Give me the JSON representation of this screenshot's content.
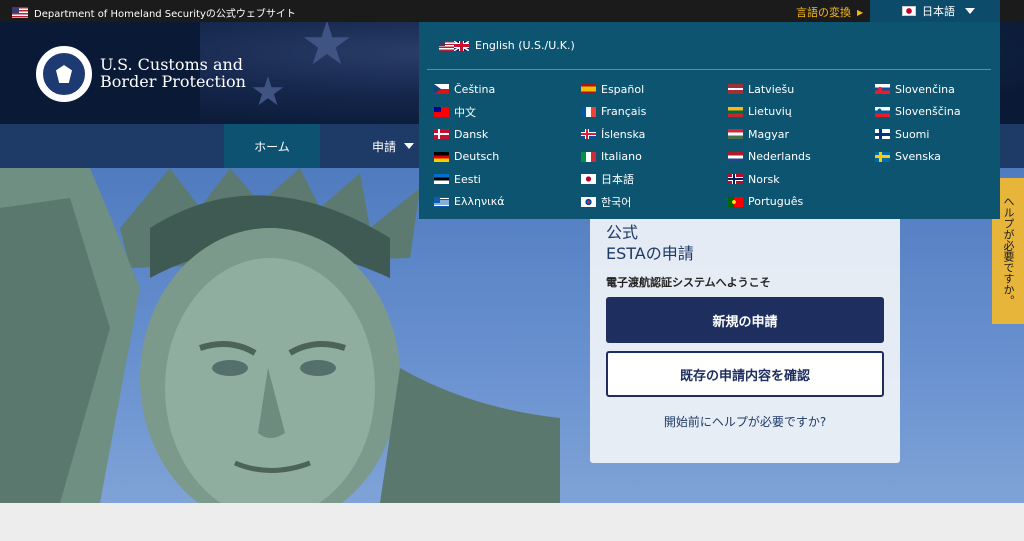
{
  "topbar": {
    "agency_text": "Department of Homeland Securityの公式ウェブサイト",
    "language_toggle_label": "言語の変換",
    "current_language": "日本語"
  },
  "header": {
    "agency_name_line1": "U.S. Customs and",
    "agency_name_line2": "Border Protection"
  },
  "nav": {
    "home": "ホーム",
    "apply": "申請"
  },
  "card": {
    "title_line1": "公式",
    "title_line2": "ESTAの申請",
    "subtitle": "電子渡航認証システムへようこそ",
    "new_application": "新規の申請",
    "existing_application": "既存の申請内容を確認",
    "help_link": "開始前にヘルプが必要ですか?"
  },
  "side_help": {
    "label": "ヘルプが必要ですか。"
  },
  "language_menu": {
    "english": "English (U.S./U.K.)",
    "columns": [
      [
        {
          "label": "Čeština",
          "flag": "cs"
        },
        {
          "label": "中文",
          "flag": "zh"
        },
        {
          "label": "Dansk",
          "flag": "da"
        },
        {
          "label": "Deutsch",
          "flag": "de"
        },
        {
          "label": "Eesti",
          "flag": "et"
        },
        {
          "label": "Ελληνικά",
          "flag": "el"
        }
      ],
      [
        {
          "label": "Español",
          "flag": "es"
        },
        {
          "label": "Français",
          "flag": "fr"
        },
        {
          "label": "Íslenska",
          "flag": "is"
        },
        {
          "label": "Italiano",
          "flag": "it"
        },
        {
          "label": "日本語",
          "flag": "ja"
        },
        {
          "label": "한국어",
          "flag": "ko"
        }
      ],
      [
        {
          "label": "Latviešu",
          "flag": "lv"
        },
        {
          "label": "Lietuvių",
          "flag": "lt"
        },
        {
          "label": "Magyar",
          "flag": "hu"
        },
        {
          "label": "Nederlands",
          "flag": "nl"
        },
        {
          "label": "Norsk",
          "flag": "no"
        },
        {
          "label": "Português",
          "flag": "pt"
        }
      ],
      [
        {
          "label": "Slovenčina",
          "flag": "sk"
        },
        {
          "label": "Slovenščina",
          "flag": "sl"
        },
        {
          "label": "Suomi",
          "flag": "fi"
        },
        {
          "label": "Svenska",
          "flag": "sv"
        }
      ]
    ]
  },
  "colors": {
    "navy": "#1e2f5f",
    "teal_panel": "#0d5470",
    "accent_gold": "#f5b916",
    "help_tab": "#e6b53a"
  }
}
